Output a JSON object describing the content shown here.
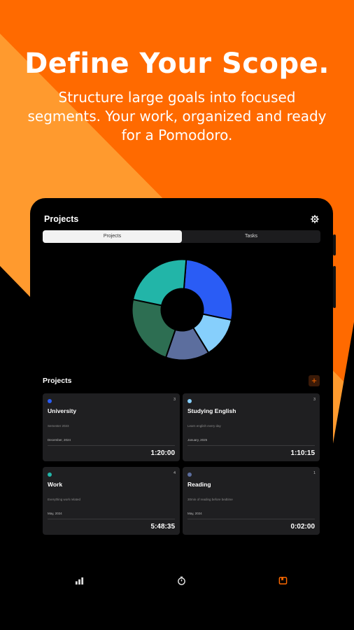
{
  "promo": {
    "headline": "Define Your Scope.",
    "subtext": "Structure large goals into focused segments. Your work, organized and ready for a Pomodoro."
  },
  "app": {
    "title": "Projects",
    "segments": [
      "Projects",
      "Tasks"
    ],
    "selected_segment": "Projects",
    "section_title": "Projects",
    "add_label": "+"
  },
  "chart_data": {
    "type": "pie",
    "variant": "donut",
    "slices": [
      {
        "color": "#2A5CF5",
        "value": 27
      },
      {
        "color": "#86CFFC",
        "value": 13
      },
      {
        "color": "#5C6E9E",
        "value": 14
      },
      {
        "color": "#2D6E52",
        "value": 23
      },
      {
        "color": "#22B5A8",
        "value": 23
      }
    ]
  },
  "projects": [
    {
      "name": "University",
      "color": "#2A5CF5",
      "count": "3",
      "description": "Semester 2023",
      "date": "December, 2024",
      "time": "1:20:00"
    },
    {
      "name": "Studying English",
      "color": "#86CFFC",
      "count": "3",
      "description": "Learn english every day",
      "date": "January, 2025",
      "time": "1:10:15"
    },
    {
      "name": "Work",
      "color": "#22B5A8",
      "count": "4",
      "description": "Everything work related",
      "date": "May, 2024",
      "time": "5:48:35"
    },
    {
      "name": "Reading",
      "color": "#5C6E9E",
      "count": "1",
      "description": "30min of reading before bedtime",
      "date": "May, 2024",
      "time": "0:02:00"
    }
  ],
  "nav": {
    "items": [
      "stats-icon",
      "timer-icon",
      "projects-icon"
    ],
    "active": "projects-icon",
    "active_color": "#FF6A00"
  }
}
